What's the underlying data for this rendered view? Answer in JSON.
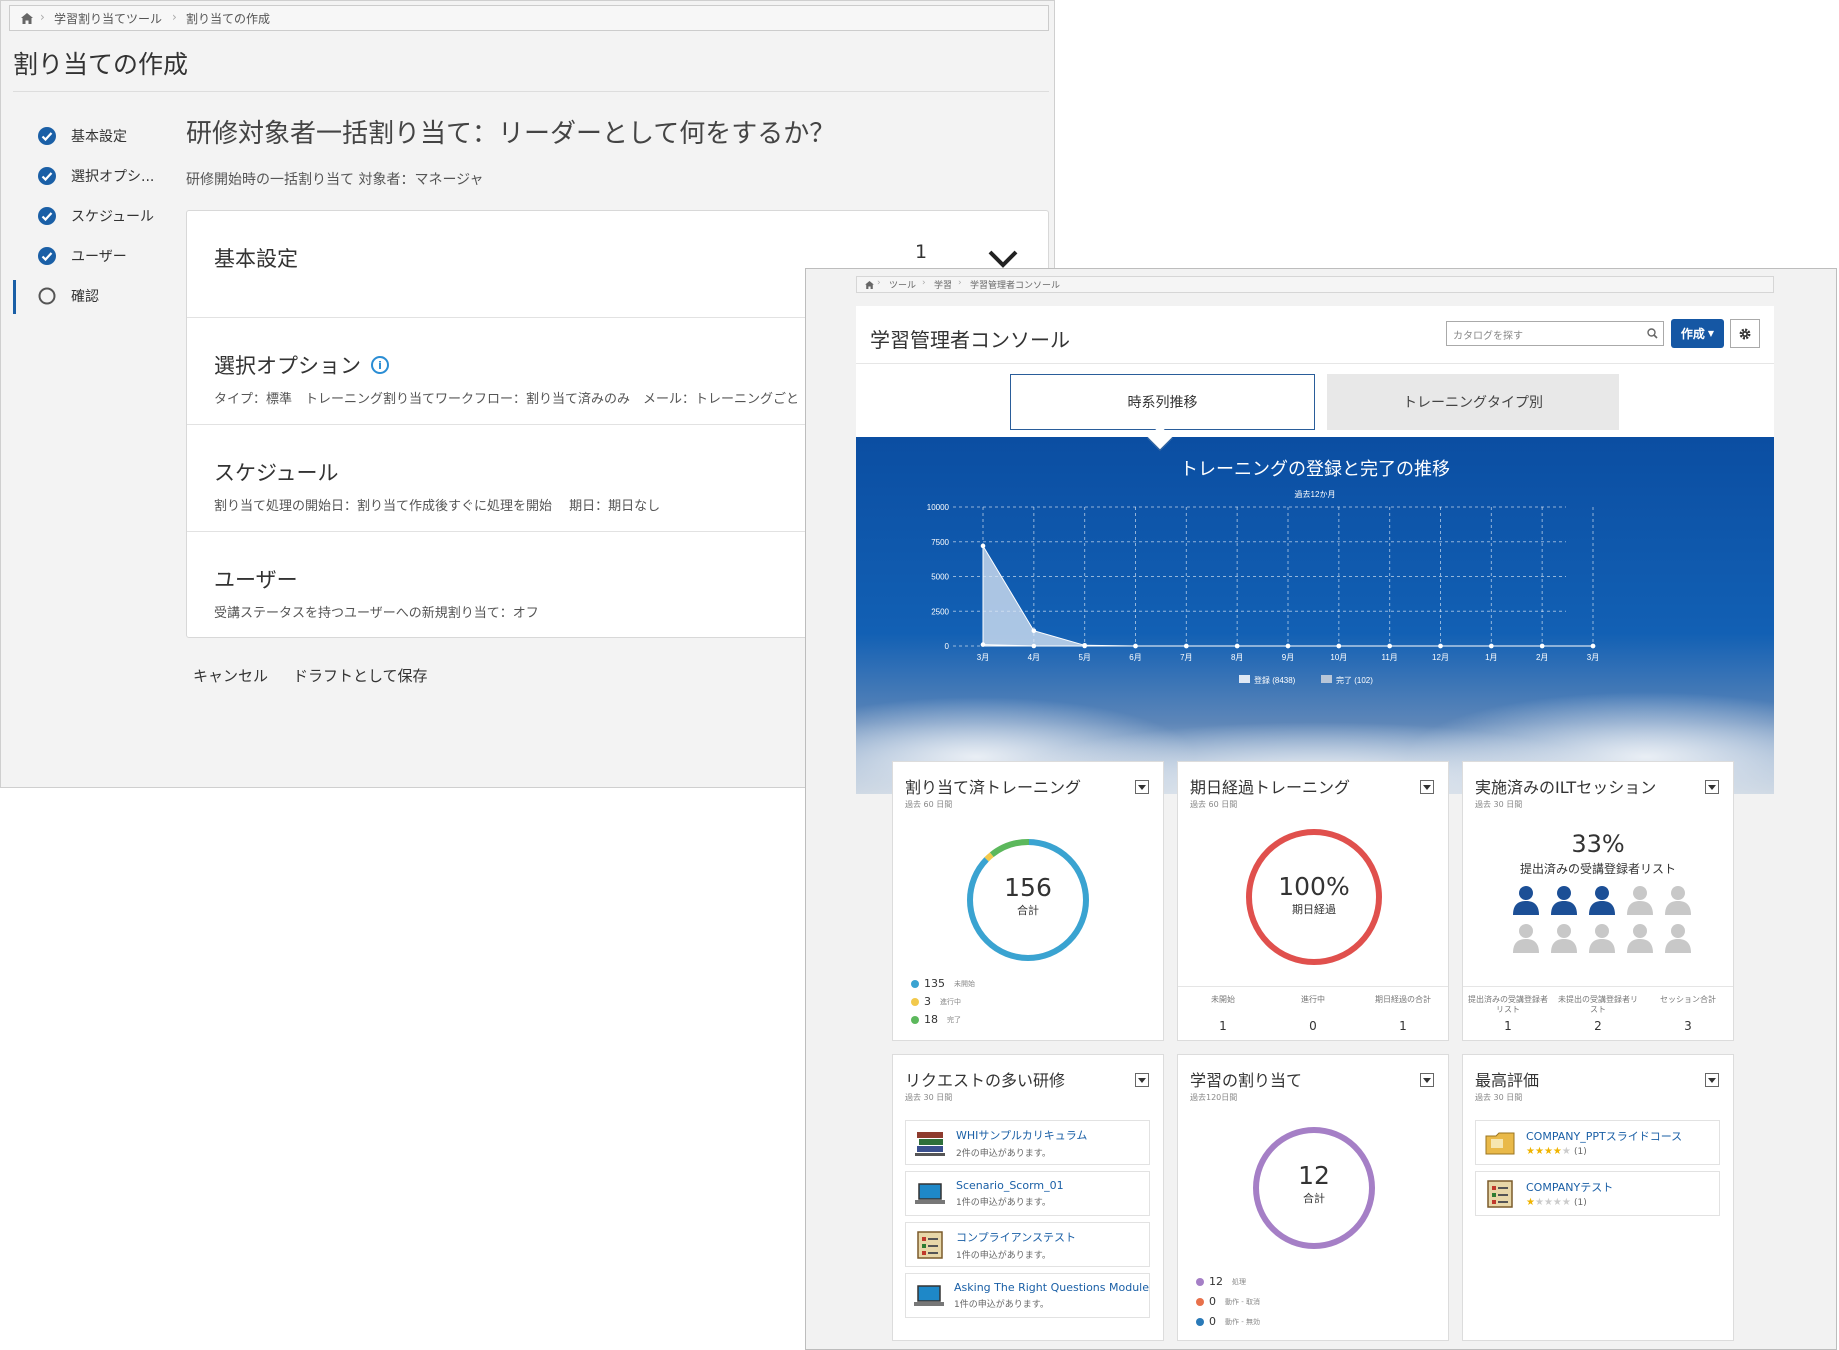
{
  "back": {
    "breadcrumb": [
      "学習割り当てツール",
      "割り当ての作成"
    ],
    "title": "割り当ての作成",
    "steps": [
      {
        "label": "基本設定",
        "state": "done"
      },
      {
        "label": "選択オプシ...",
        "state": "done"
      },
      {
        "label": "スケジュール",
        "state": "done"
      },
      {
        "label": "ユーザー",
        "state": "done"
      },
      {
        "label": "確認",
        "state": "current"
      }
    ],
    "heading": "研修対象者一括割り当て：リーダーとして何をするか？",
    "subtitle": "研修開始時の一括割り当て 対象者：マネージャ",
    "sections": [
      {
        "title": "基本設定",
        "detail": "",
        "number": "1"
      },
      {
        "title": "選択オプション",
        "detail": "タイプ：標準　トレーニング割り当てワークフロー：割り当て済みのみ　メール：トレーニングごと"
      },
      {
        "title": "スケジュール",
        "detail": "割り当て処理の開始日：割り当て作成後すぐに処理を開始　 期日：期日なし"
      },
      {
        "title": "ユーザー",
        "detail": "受講ステータスを持つユーザーへの新規割り当て：オフ"
      }
    ],
    "cancel": "キャンセル",
    "save_draft": "ドラフトとして保存"
  },
  "front": {
    "breadcrumb": [
      "ツール",
      "学習",
      "学習管理者コンソール"
    ],
    "title": "学習管理者コンソール",
    "search_placeholder": "カタログを探す",
    "create_label": "作成",
    "tabs": [
      "時系列推移",
      "トレーニングタイプ別"
    ],
    "widgets": {
      "assigned": {
        "title": "割り当て済トレーニング",
        "sub": "過去 60 日間",
        "total": "156",
        "total_label": "合計",
        "legend": [
          {
            "value": "135",
            "label": "未開始",
            "color": "#3aa3d1"
          },
          {
            "value": "3",
            "label": "進行中",
            "color": "#f2c94c"
          },
          {
            "value": "18",
            "label": "完了",
            "color": "#5cb85c"
          }
        ]
      },
      "overdue": {
        "title": "期日経過トレーニング",
        "sub": "過去 60 日間",
        "pct": "100%",
        "pct_label": "期日経過",
        "stats": [
          {
            "h": "未開始",
            "v": "1"
          },
          {
            "h": "進行中",
            "v": "0"
          },
          {
            "h": "期日経過の合計",
            "v": "1"
          }
        ]
      },
      "ilt": {
        "title": "実施済みのILTセッション",
        "sub": "過去 30 日間",
        "pct": "33%",
        "desc": "提出済みの受講登録者リスト",
        "filled": 3,
        "total": 10,
        "stats": [
          {
            "h": "提出済みの受講登録者リスト",
            "v": "1"
          },
          {
            "h": "未提出の受講登録者リスト",
            "v": "2"
          },
          {
            "h": "セッション合計",
            "v": "3"
          }
        ]
      },
      "requested": {
        "title": "リクエストの多い研修",
        "sub": "過去 30 日間",
        "items": [
          {
            "name": "WHIサンプルカリキュラム",
            "desc": "2件の申込があります。",
            "icon": "books-icon"
          },
          {
            "name": "Scenario_Scorm_01",
            "desc": "1件の申込があります。",
            "icon": "laptop-icon"
          },
          {
            "name": "コンプライアンステスト",
            "desc": "1件の申込があります。",
            "icon": "test-icon"
          },
          {
            "name": "Asking The Right Questions Module",
            "desc": "1件の申込があります。",
            "icon": "laptop-icon"
          }
        ]
      },
      "learning": {
        "title": "学習の割り当て",
        "sub": "過去120日間",
        "total": "12",
        "total_label": "合計",
        "legend": [
          {
            "value": "12",
            "label": "処理",
            "color": "#a57fc6"
          },
          {
            "value": "0",
            "label": "動作 - 取消",
            "color": "#e8714b"
          },
          {
            "value": "0",
            "label": "動作 - 無効",
            "color": "#2a7ab8"
          }
        ]
      },
      "rated": {
        "title": "最高評価",
        "sub": "過去 30 日間",
        "items": [
          {
            "name": "COMPANY_PPTスライドコース",
            "stars": 4,
            "count": "(1)",
            "icon": "folder-icon"
          },
          {
            "name": "COMPANYテスト",
            "stars": 1,
            "count": "(1)",
            "icon": "test-icon"
          }
        ]
      }
    }
  },
  "chart_data": {
    "type": "area",
    "title": "トレーニングの登録と完了の推移",
    "subtitle": "過去12か月",
    "categories": [
      "3月",
      "4月",
      "5月",
      "6月",
      "7月",
      "8月",
      "9月",
      "10月",
      "11月",
      "12月",
      "1月",
      "2月",
      "3月"
    ],
    "series": [
      {
        "name": "登録 (8438)",
        "values": [
          7200,
          1100,
          50,
          0,
          0,
          0,
          0,
          0,
          0,
          0,
          0,
          0,
          0
        ]
      },
      {
        "name": "完了 (102)",
        "values": [
          102,
          0,
          0,
          0,
          0,
          0,
          0,
          0,
          0,
          0,
          0,
          0,
          0
        ]
      }
    ],
    "yticks": [
      "0",
      "2500",
      "5000",
      "7500",
      "10000"
    ],
    "ylim": [
      0,
      10000
    ],
    "grid": true,
    "legend_position": "bottom"
  }
}
